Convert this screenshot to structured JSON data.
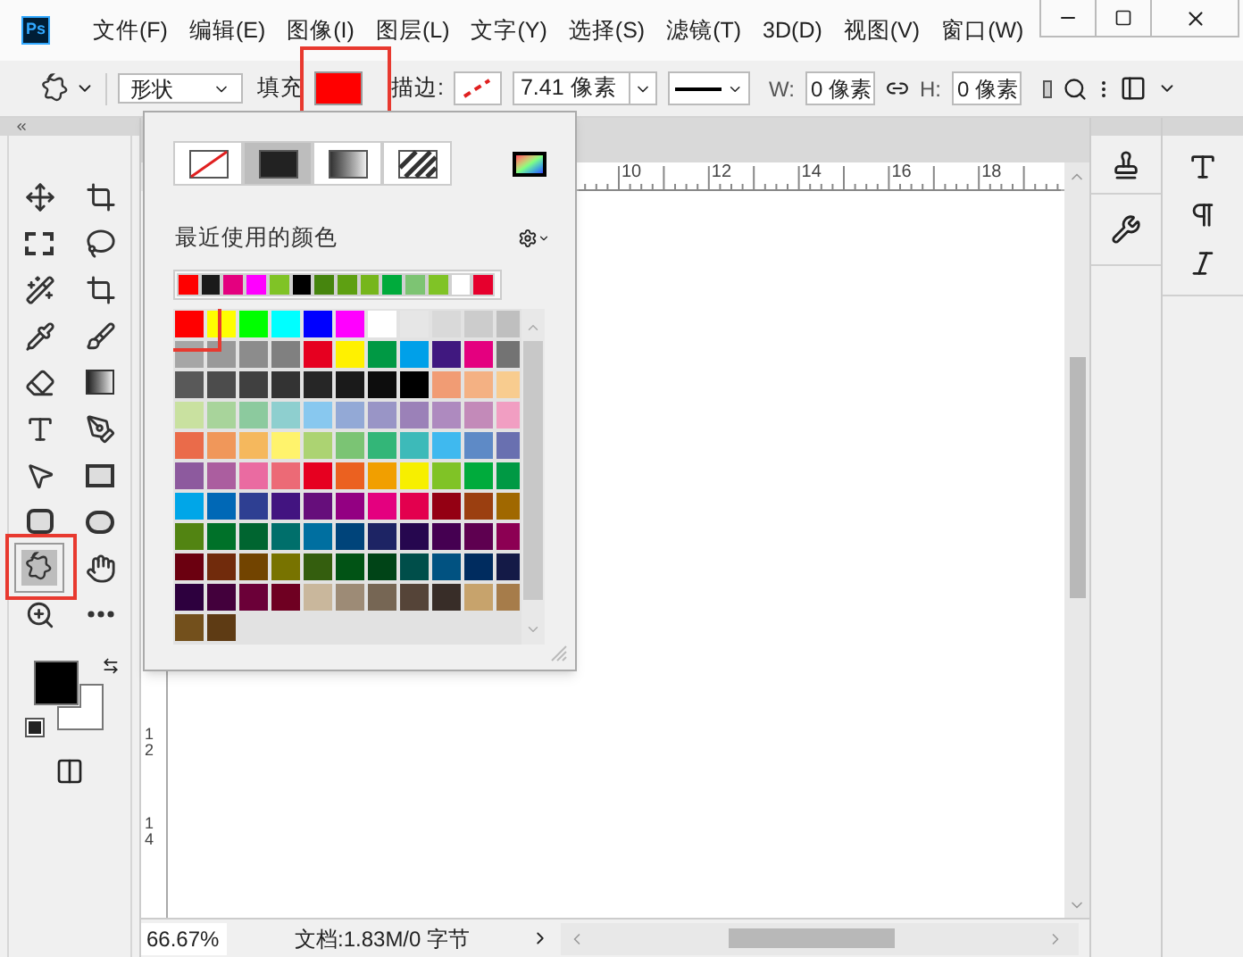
{
  "app": {
    "logo": "Ps"
  },
  "menu": [
    "文件(F)",
    "编辑(E)",
    "图像(I)",
    "图层(L)",
    "文字(Y)",
    "选择(S)",
    "滤镜(T)",
    "3D(D)",
    "视图(V)",
    "窗口(W)"
  ],
  "options_bar": {
    "mode": "形状",
    "fill_label": "填充",
    "fill": {
      "color": "#ff0000",
      "highlighted": true
    },
    "stroke_label": "描边:",
    "stroke_width": "7.41 像素",
    "w_label": "W:",
    "w_value": "0 像素",
    "h_label": "H:",
    "h_value": "0 像素"
  },
  "fill_popup": {
    "fill_types": [
      {
        "selected": false
      },
      {
        "selected": true
      },
      {
        "selected": false
      },
      {
        "selected": false
      }
    ],
    "recent_label": "最近使用的颜色",
    "recent": [
      {
        "color": "#ff0000"
      },
      {
        "color": "#1a1a1a"
      },
      {
        "color": "#e4007f"
      },
      {
        "color": "#ff00ff"
      },
      {
        "color": "#80c326"
      },
      {
        "color": "#000000"
      },
      {
        "color": "#46850e"
      },
      {
        "color": "#5ea012"
      },
      {
        "color": "#76b61c"
      },
      {
        "color": "#00ab3c"
      },
      {
        "color": "#7dc473"
      },
      {
        "color": "#80c326"
      },
      {
        "color": "#ffffff"
      },
      {
        "color": "#e6002d"
      }
    ],
    "swatches": [
      {
        "color": "#ff0000",
        "highlighted": true
      },
      {
        "color": "#ffff00"
      },
      {
        "color": "#00ff00"
      },
      {
        "color": "#00ffff"
      },
      {
        "color": "#0000ff"
      },
      {
        "color": "#ff00ff"
      },
      {
        "color": "#ffffff"
      },
      {
        "color": "#e6e6e6"
      },
      {
        "color": "#d9d9d9"
      },
      {
        "color": "#cccccc"
      },
      {
        "color": "#bfbfbf"
      },
      {
        "color": "#a6a6a6"
      },
      {
        "color": "#999999"
      },
      {
        "color": "#8c8c8c"
      },
      {
        "color": "#808080"
      },
      {
        "color": "#e60020"
      },
      {
        "color": "#fff100"
      },
      {
        "color": "#009944"
      },
      {
        "color": "#00a0e9"
      },
      {
        "color": "#40187f"
      },
      {
        "color": "#e4007f"
      },
      {
        "color": "#737373"
      },
      {
        "color": "#595959"
      },
      {
        "color": "#4c4c4c"
      },
      {
        "color": "#404040"
      },
      {
        "color": "#333333"
      },
      {
        "color": "#262626"
      },
      {
        "color": "#1a1a1a"
      },
      {
        "color": "#0d0d0d"
      },
      {
        "color": "#000000"
      },
      {
        "color": "#f19c74"
      },
      {
        "color": "#f4b183"
      },
      {
        "color": "#f8cc8f"
      },
      {
        "color": "#c9e1a0"
      },
      {
        "color": "#a8d49b"
      },
      {
        "color": "#8cca9e"
      },
      {
        "color": "#8ecfcf"
      },
      {
        "color": "#88c8ef"
      },
      {
        "color": "#93a9d6"
      },
      {
        "color": "#9995c6"
      },
      {
        "color": "#9b81b8"
      },
      {
        "color": "#ae8abf"
      },
      {
        "color": "#c38ab9"
      },
      {
        "color": "#f19ec2"
      },
      {
        "color": "#ea6b4a"
      },
      {
        "color": "#f0975a"
      },
      {
        "color": "#f5b85d"
      },
      {
        "color": "#fff36c"
      },
      {
        "color": "#acd372"
      },
      {
        "color": "#7bc474"
      },
      {
        "color": "#33b678"
      },
      {
        "color": "#3dbab9"
      },
      {
        "color": "#3fb9ef"
      },
      {
        "color": "#5e8ac6"
      },
      {
        "color": "#6970b0"
      },
      {
        "color": "#8d5a9e"
      },
      {
        "color": "#ab5e9f"
      },
      {
        "color": "#ea6ba1"
      },
      {
        "color": "#ec6a76"
      },
      {
        "color": "#e60020"
      },
      {
        "color": "#eb6120"
      },
      {
        "color": "#f19f00"
      },
      {
        "color": "#f7ef00"
      },
      {
        "color": "#80c326"
      },
      {
        "color": "#00ab3c"
      },
      {
        "color": "#009944"
      },
      {
        "color": "#00a6e8"
      },
      {
        "color": "#0068b6"
      },
      {
        "color": "#2e3f92"
      },
      {
        "color": "#421480"
      },
      {
        "color": "#660e7b"
      },
      {
        "color": "#930082"
      },
      {
        "color": "#e4007f"
      },
      {
        "color": "#e3004e"
      },
      {
        "color": "#940013"
      },
      {
        "color": "#9b3f10"
      },
      {
        "color": "#a06800"
      },
      {
        "color": "#528412"
      },
      {
        "color": "#007129"
      },
      {
        "color": "#006530"
      },
      {
        "color": "#006f6b"
      },
      {
        "color": "#006fa0"
      },
      {
        "color": "#00447a"
      },
      {
        "color": "#1d2464"
      },
      {
        "color": "#26074f"
      },
      {
        "color": "#450051"
      },
      {
        "color": "#5e0050"
      },
      {
        "color": "#8c0053"
      },
      {
        "color": "#6b0010"
      },
      {
        "color": "#712b0c"
      },
      {
        "color": "#724400"
      },
      {
        "color": "#787300"
      },
      {
        "color": "#345e0e"
      },
      {
        "color": "#015315"
      },
      {
        "color": "#004417"
      },
      {
        "color": "#004e4a"
      },
      {
        "color": "#015281"
      },
      {
        "color": "#002c5f"
      },
      {
        "color": "#141a47"
      },
      {
        "color": "#2d003e"
      },
      {
        "color": "#43003c"
      },
      {
        "color": "#6b0038"
      },
      {
        "color": "#6f0022"
      },
      {
        "color": "#c9b79c"
      },
      {
        "color": "#9d8b76"
      },
      {
        "color": "#766654"
      },
      {
        "color": "#554438"
      },
      {
        "color": "#382d28"
      },
      {
        "color": "#c7a36c"
      },
      {
        "color": "#a67c4a"
      },
      {
        "color": "#73501c"
      },
      {
        "color": "#5e3b14"
      }
    ]
  },
  "tools": [
    {
      "selected": false
    },
    {
      "selected": false
    },
    {
      "selected": false
    },
    {
      "selected": false
    },
    {
      "selected": false
    },
    {
      "selected": false
    },
    {
      "selected": false
    },
    {
      "selected": false
    },
    {
      "selected": false
    },
    {
      "selected": false
    },
    {
      "selected": false
    },
    {
      "selected": false
    },
    {
      "selected": false
    },
    {
      "selected": false
    },
    {
      "selected": false
    },
    {
      "selected": false
    },
    {
      "selected": true,
      "highlighted": true
    },
    {
      "selected": false
    },
    {
      "selected": false
    },
    {
      "selected": false
    }
  ],
  "foreground": {
    "color": "#000000"
  },
  "background": {
    "color": "#ffffff"
  },
  "ruler": {
    "horizontal": [
      "10",
      "12",
      "14",
      "16",
      "18"
    ],
    "vertical": [
      "12",
      "14"
    ]
  },
  "status_bar": {
    "zoom": "66.67%",
    "doc_info": "文档:1.83M/0 字节"
  }
}
